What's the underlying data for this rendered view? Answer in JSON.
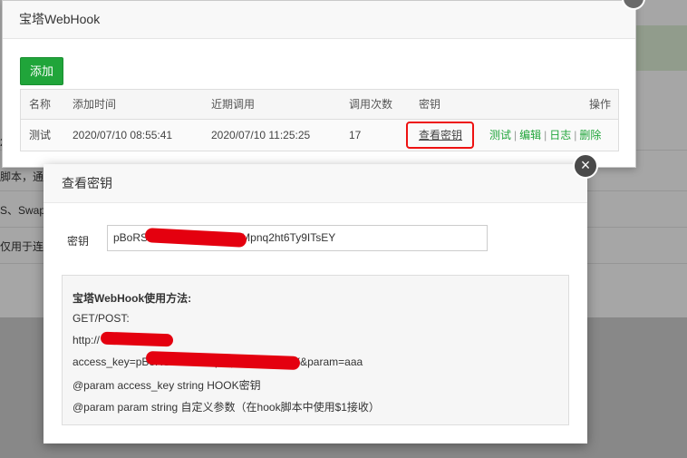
{
  "background": {
    "fragment_1": "脚本，通常",
    "fragment_2": "S、Swap",
    "fragment_3": "仅用于连",
    "fragment_4": "2"
  },
  "webhook_window": {
    "title": "宝塔WebHook",
    "add_button": "添加",
    "close_icon": "×",
    "columns": [
      "名称",
      "添加时间",
      "近期调用",
      "调用次数",
      "密钥",
      "操作"
    ],
    "row": {
      "name": "测试",
      "added": "2020/07/10 08:55:41",
      "last_call": "2020/07/10 11:25:25",
      "count": "17",
      "key_link": "查看密钥",
      "actions": [
        "测试",
        "编辑",
        "日志",
        "删除"
      ],
      "separator": "|"
    }
  },
  "key_window": {
    "title": "查看密钥",
    "close_icon": "×",
    "key_label": "密钥",
    "key_value": "pBoRS               Ykc5n7SIc3wJ9HzMpnq2ht6Ty9ITsEY",
    "usage": {
      "title": "宝塔WebHook使用方法:",
      "line_method": "GET/POST:",
      "line_url": "http://             4:8888/hook?",
      "line_access": "access_key=pBoRS                              wJ9HzMpnq2ht6Ty9ITsEY&param=aaa",
      "line_param1": "@param access_key string HOOK密钥",
      "line_param2": "@param param string 自定义参数（在hook脚本中使用$1接收）"
    }
  },
  "colors": {
    "accent_green": "#20a53a",
    "link_blue": "#1e4fa8",
    "highlight_red": "#e11111",
    "redaction_red": "#e4000f"
  }
}
